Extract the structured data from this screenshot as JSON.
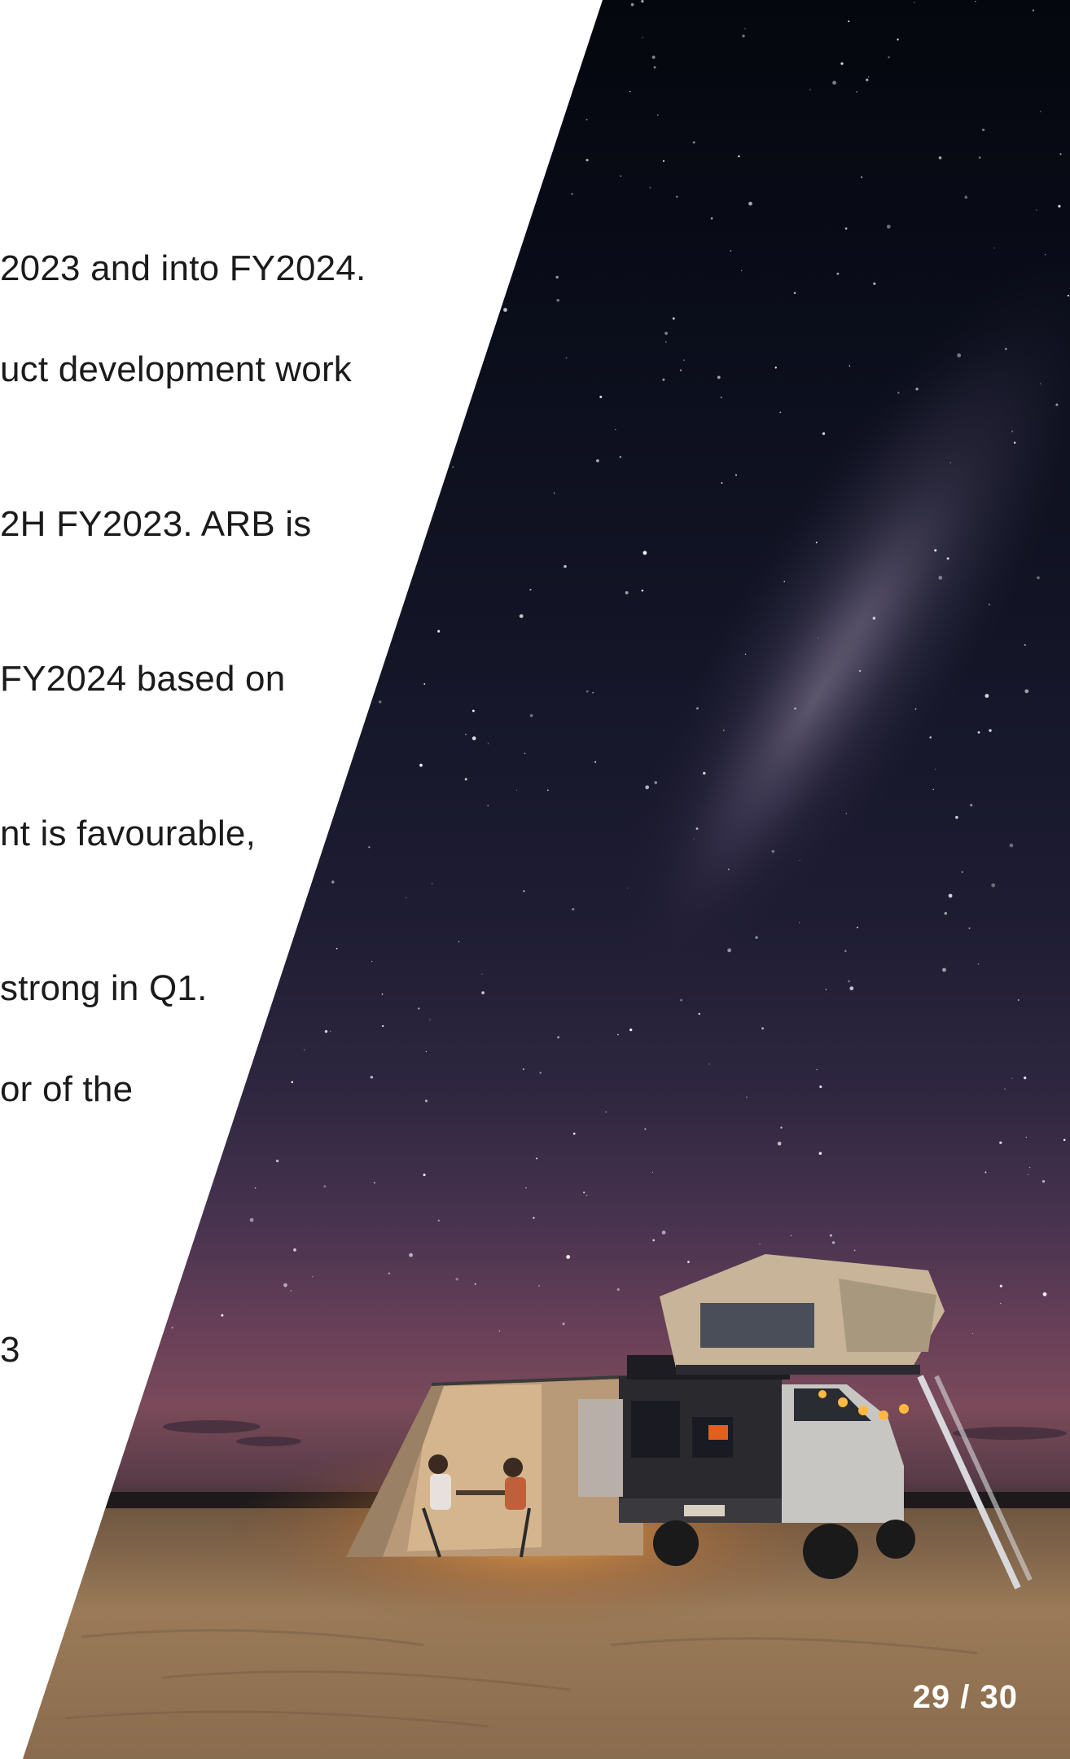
{
  "body_lines": [
    "2023 and into FY2024.",
    "uct development work",
    "2H FY2023.  ARB is",
    " FY2024 based on",
    "nt is favourable,",
    "strong in Q1.",
    "or of the",
    "3"
  ],
  "page_number": "29 / 30",
  "colors": {
    "text": "#1b1b1b",
    "background": "#ffffff",
    "page_number": "#ffffff"
  }
}
